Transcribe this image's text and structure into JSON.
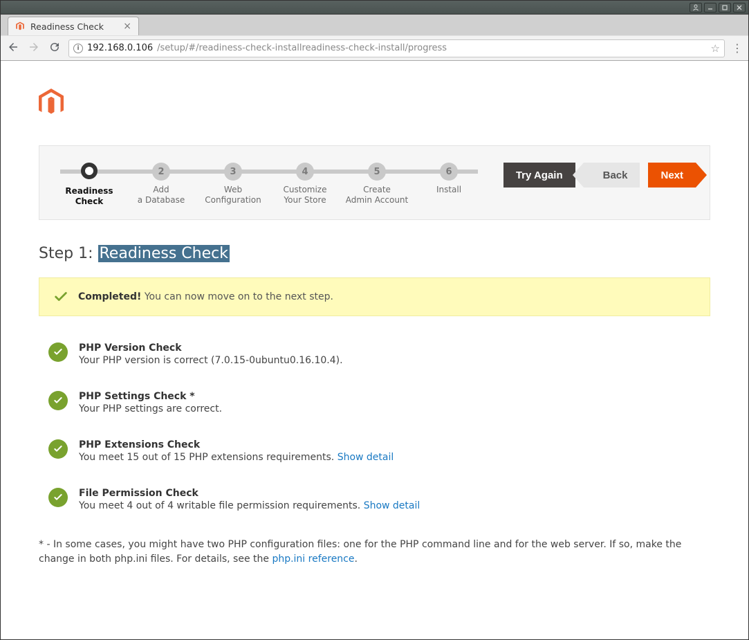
{
  "os": {
    "buttons": {
      "user": "user",
      "min": "minimize",
      "max": "maximize",
      "close": "close"
    }
  },
  "browser": {
    "tab_title": "Readiness Check",
    "url_host": "192.168.0.106",
    "url_path": "/setup/#/readiness-check-installreadiness-check-install/progress"
  },
  "wizard": {
    "steps": [
      {
        "num": "",
        "label": "Readiness\nCheck",
        "current": true
      },
      {
        "num": "2",
        "label": "Add\na Database",
        "current": false
      },
      {
        "num": "3",
        "label": "Web\nConfiguration",
        "current": false
      },
      {
        "num": "4",
        "label": "Customize\nYour Store",
        "current": false
      },
      {
        "num": "5",
        "label": "Create\nAdmin Account",
        "current": false
      },
      {
        "num": "6",
        "label": "Install",
        "current": false
      }
    ],
    "actions": {
      "try_again": "Try Again",
      "back": "Back",
      "next": "Next"
    }
  },
  "heading": {
    "prefix": "Step 1: ",
    "title": "Readiness Check"
  },
  "banner": {
    "strong": "Completed!",
    "text": " You can now move on to the next step."
  },
  "checks": [
    {
      "title": "PHP Version Check",
      "desc": "Your PHP version is correct (7.0.15-0ubuntu0.16.10.4).",
      "link": ""
    },
    {
      "title": "PHP Settings Check *",
      "desc": "Your PHP settings are correct.",
      "link": ""
    },
    {
      "title": "PHP Extensions Check",
      "desc": "You meet 15 out of 15 PHP extensions requirements. ",
      "link": "Show detail"
    },
    {
      "title": "File Permission Check",
      "desc": "You meet 4 out of 4 writable file permission requirements. ",
      "link": "Show detail"
    }
  ],
  "footnote": {
    "text_before": "* - In some cases, you might have two PHP configuration files: one for the PHP command line and for the web server. If so, make the change in both php.ini files. For details, see the ",
    "link": "php.ini reference",
    "text_after": "."
  },
  "colors": {
    "accent": "#eb5202",
    "ok_green": "#79a22e",
    "link": "#1979c3",
    "banner_bg": "#fffbbb"
  }
}
